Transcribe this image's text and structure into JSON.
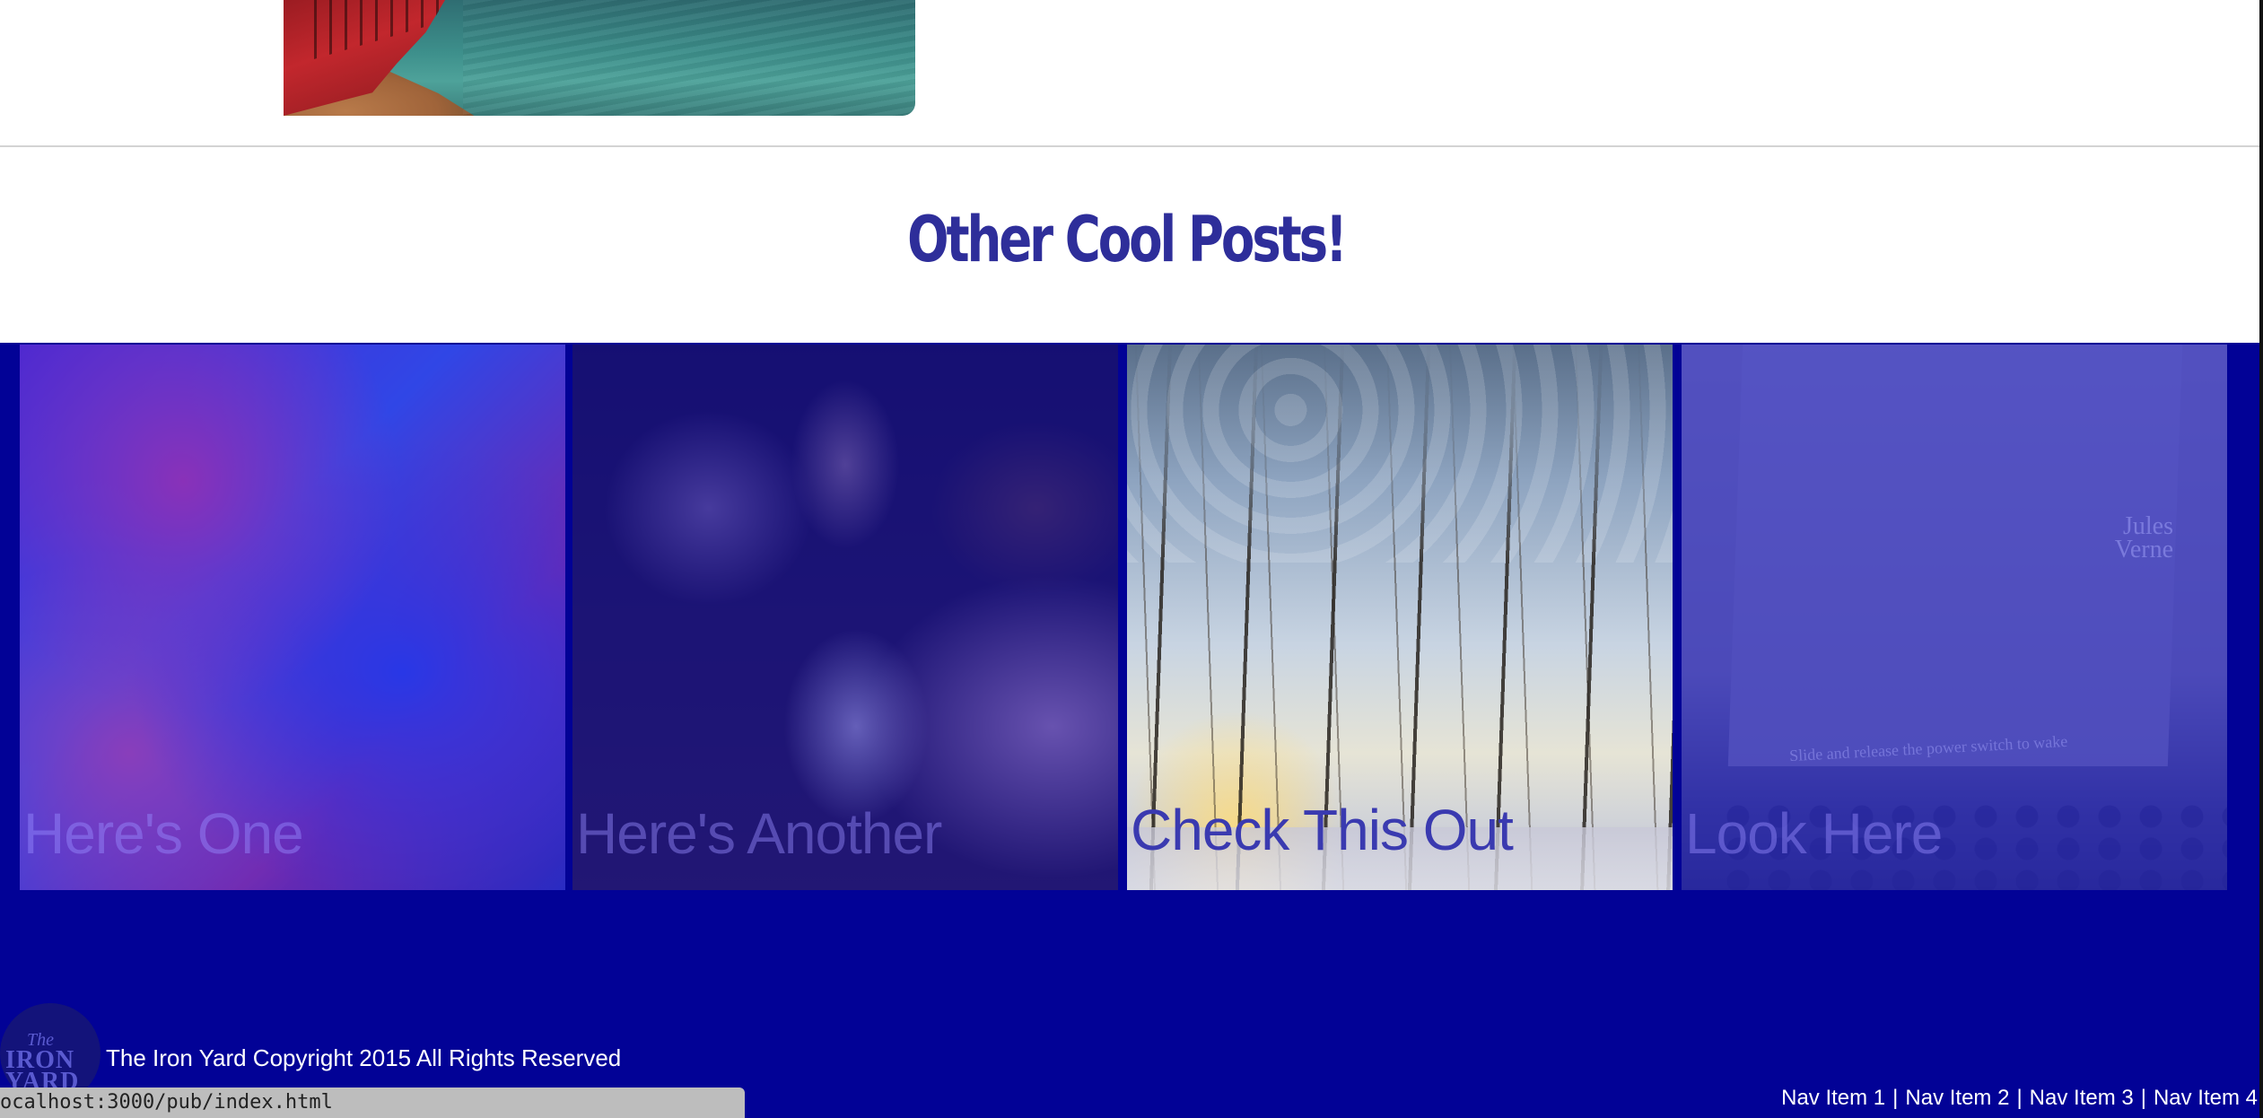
{
  "section": {
    "title": "Other Cool Posts!"
  },
  "posts": [
    {
      "caption": "Here's One",
      "image": "abstract-paint-image"
    },
    {
      "caption": "Here's Another",
      "image": "three-people-image"
    },
    {
      "caption": "Check This Out",
      "image": "trees-sky-image"
    },
    {
      "caption": "Look Here",
      "image": "ereader-portrait-image"
    }
  ],
  "post4_image_text": {
    "name_line1": "Jules",
    "name_line2": "Verne",
    "slide_text": "Slide and release the power switch to wake"
  },
  "footer": {
    "logo_the": "The",
    "logo_iron": "IRON",
    "logo_yard": "YARD",
    "copyright": "The Iron Yard Copyright 2015 All Rights Reserved",
    "nav": [
      "Nav Item 1",
      "Nav Item 2",
      "Nav Item 3",
      "Nav Item 4"
    ],
    "nav_separator": "|"
  },
  "status_bar": {
    "url": "ocalhost:3000/pub/index.html"
  },
  "colors": {
    "band": "#020296",
    "title": "#2e2e9a",
    "footer_text": "#ffffff"
  }
}
